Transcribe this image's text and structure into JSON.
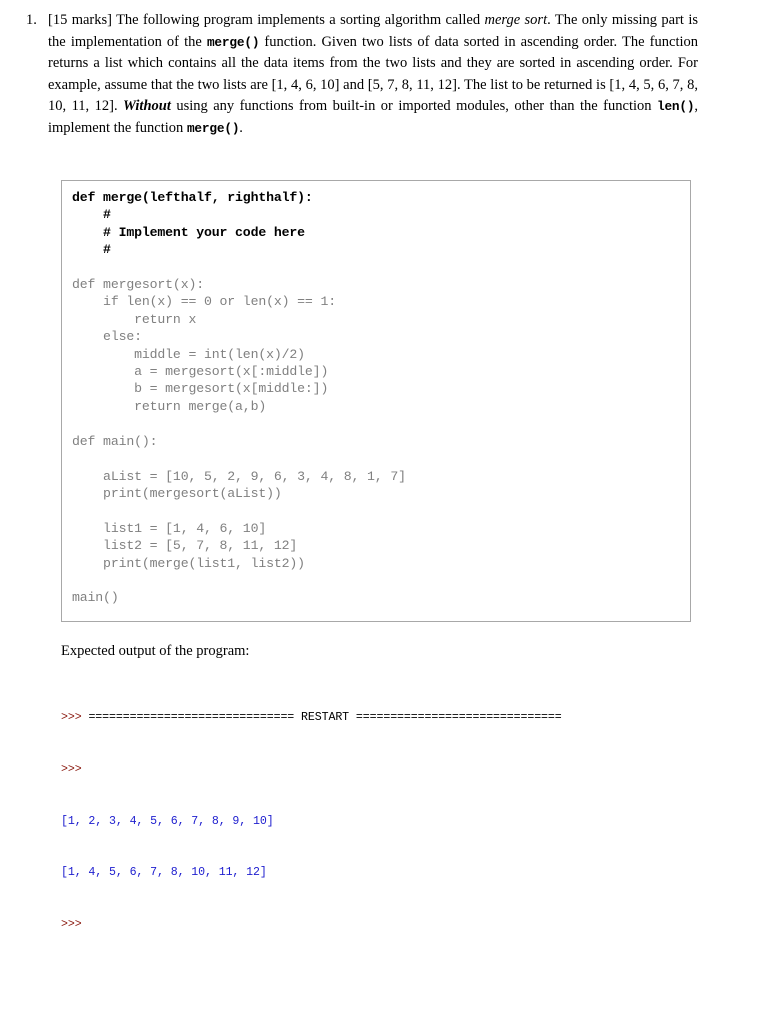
{
  "question": {
    "number": "1.",
    "marks_label": "[15 marks]",
    "segments": [
      {
        "type": "text",
        "value": "[15 marks] The following program implements a sorting algorithm called "
      },
      {
        "type": "italic",
        "value": "merge sort"
      },
      {
        "type": "text",
        "value": ". The only missing part is the implementation of the "
      },
      {
        "type": "mono-bold",
        "value": "merge()"
      },
      {
        "type": "text",
        "value": " function. Given two lists of data sorted in ascending order. The function returns a list which contains all the data items from the two lists and they are sorted in ascending order. For example, assume that the two lists are [1, 4, 6, 10] and [5, 7, 8, 11, 12]. The list to be returned is [1, 4, 5, 6, 7, 8, 10, 11, 12]. "
      },
      {
        "type": "bold-italic",
        "value": "Without"
      },
      {
        "type": "text",
        "value": " using any functions from built-in or imported modules, other than the function "
      },
      {
        "type": "mono-bold",
        "value": "len()"
      },
      {
        "type": "text",
        "value": ", implement the function "
      },
      {
        "type": "mono-bold",
        "value": "merge()"
      },
      {
        "type": "text",
        "value": "."
      }
    ],
    "full_text": "[15 marks] The following program implements a sorting algorithm called merge sort. The only missing part is the implementation of the merge() function. Given two lists of data sorted in ascending order. The function returns a list which contains all the data items from the two lists and they are sorted in ascending order. For example, assume that the two lists are [1, 4, 6, 10] and [5, 7, 8, 11, 12]. The list to be returned is [1, 4, 5, 6, 7, 8, 10, 11, 12]. Without using any functions from built-in or imported modules, other than the function len(), implement the function merge()."
  },
  "code": {
    "bold_part": "def merge(lefthalf, righthalf):\n    #\n    # Implement your code here\n    #",
    "rest_part": "\ndef mergesort(x):\n    if len(x) == 0 or len(x) == 1:\n        return x\n    else:\n        middle = int(len(x)/2)\n        a = mergesort(x[:middle])\n        b = mergesort(x[middle:])\n        return merge(a,b)\n\ndef main():\n\n    aList = [10, 5, 2, 9, 6, 3, 4, 8, 1, 7]\n    print(mergesort(aList))\n\n    list1 = [1, 4, 6, 10]\n    list2 = [5, 7, 8, 11, 12]\n    print(merge(list1, list2))\n\nmain()",
    "border_color": "#a8a8a8",
    "gray_color": "#808080"
  },
  "caption": {
    "text": "Expected output of the program:"
  },
  "console": {
    "prompt": ">>>",
    "restart_label": "RESTART",
    "equals_left": "==============================",
    "equals_right": "==============================",
    "line1_prompt": ">>>",
    "line2_prompt": ">>>",
    "output_line_1": "[1, 2, 3, 4, 5, 6, 7, 8, 9, 10]",
    "output_line_2": "[1, 4, 5, 6, 7, 8, 10, 11, 12]",
    "line5_prompt": ">>>",
    "prompt_color": "#8b1a10",
    "result_color": "#2020cf"
  }
}
